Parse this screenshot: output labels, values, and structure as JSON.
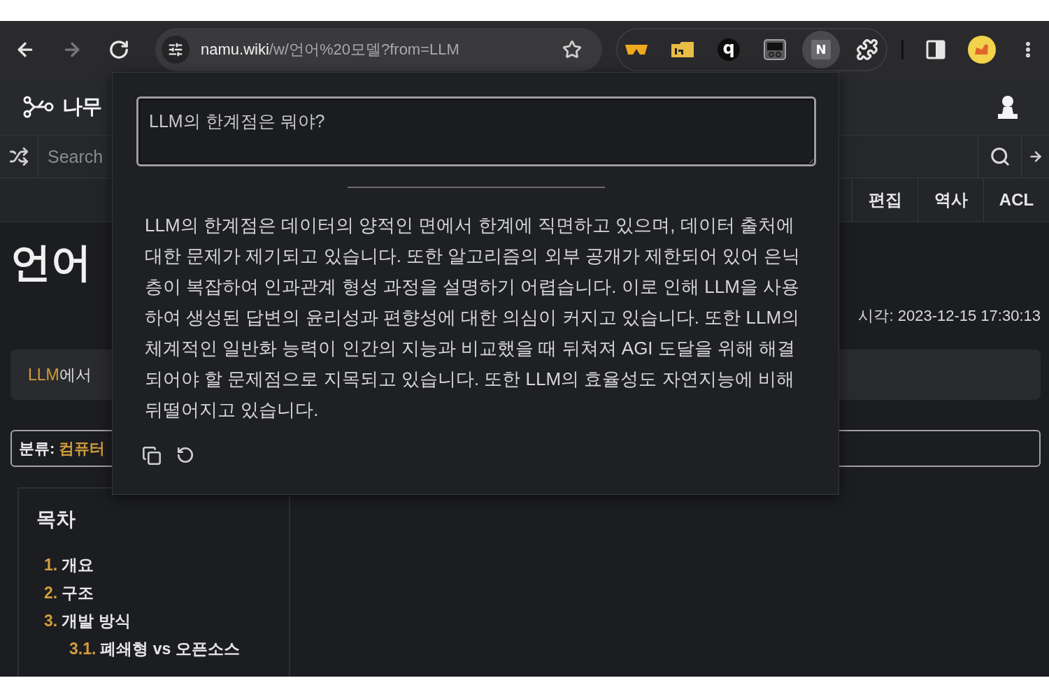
{
  "browser": {
    "nav": [
      {
        "kind": "back",
        "disabled": false
      },
      {
        "kind": "forward",
        "disabled": true
      },
      {
        "kind": "reload",
        "disabled": false
      }
    ],
    "url": {
      "host": "namu.wiki",
      "path": "/w/언어%20모델?from=LLM"
    },
    "extensions": [
      {
        "kind": "glasses",
        "active": false
      },
      {
        "kind": "folder",
        "active": false
      },
      {
        "kind": "letter-round",
        "glyph": "q",
        "active": false
      },
      {
        "kind": "window",
        "active": false
      },
      {
        "kind": "letter-square",
        "glyph": "N",
        "active": true
      },
      {
        "kind": "puzzle",
        "active": false
      }
    ]
  },
  "wiki": {
    "logo": "나무",
    "search": {
      "placeholder": "Search"
    },
    "actions": [
      "편집",
      "역사",
      "ACL"
    ],
    "title": "언어",
    "modified": "시각: 2023-12-15 17:30:13",
    "notice": {
      "link": "LLM",
      "text": "에서"
    },
    "category": {
      "label": "분류:",
      "link": "컴퓨터"
    },
    "toc": {
      "title": "목차",
      "items": [
        {
          "number": "1.",
          "label": "개요"
        },
        {
          "number": "2.",
          "label": "구조"
        },
        {
          "number": "3.",
          "label": "개발 방식",
          "children": [
            {
              "number": "3.1.",
              "label": "폐쇄형 vs 오픈소스"
            }
          ]
        }
      ]
    }
  },
  "assistant": {
    "question": "LLM의 한계점은 뭐야?",
    "answer": "LLM의 한계점은 데이터의 양적인 면에서 한계에 직면하고 있으며, 데이터 출처에 대한 문제가 제기되고 있습니다. 또한 알고리즘의 외부 공개가 제한되어 있어 은닉층이 복잡하여 인과관계 형성 과정을 설명하기 어렵습니다. 이로 인해 LLM을 사용하여 생성된 답변의 윤리성과 편향성에 대한 의심이 커지고 있습니다. 또한 LLM의 체계적인 일반화 능력이 인간의 지능과 비교했을 때 뒤쳐져 AGI 도달을 위해 해결되어야 할 문제점으로 지목되고 있습니다. 또한 LLM의 효율성도 자연지능에 비해 뒤떨어지고 있습니다."
  }
}
